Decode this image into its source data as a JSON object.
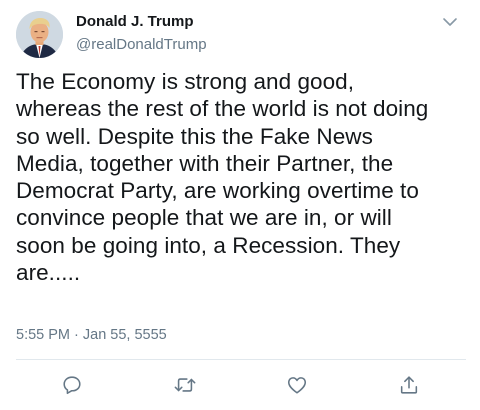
{
  "author": {
    "name": "Donald J. Trump",
    "handle": "@realDonaldTrump",
    "avatar_icon": "profile-avatar"
  },
  "tweet": {
    "text": "The Economy is strong and good,\nwhereas the rest of the world is not doing\nso well. Despite this the Fake News\nMedia, together with their Partner, the\nDemocrat Party, are working overtime to\nconvince people that we are in, or will\nsoon be going into, a Recession. They\nare.....",
    "timestamp": "5:55 PM · Jan 55, 5555"
  },
  "actions": {
    "reply_icon": "reply-icon",
    "retweet_icon": "retweet-icon",
    "like_icon": "heart-icon",
    "share_icon": "share-icon"
  },
  "colors": {
    "primary_text": "#14171a",
    "secondary_text": "#657786",
    "icon": "#657786",
    "divider": "#e1e8ed"
  }
}
